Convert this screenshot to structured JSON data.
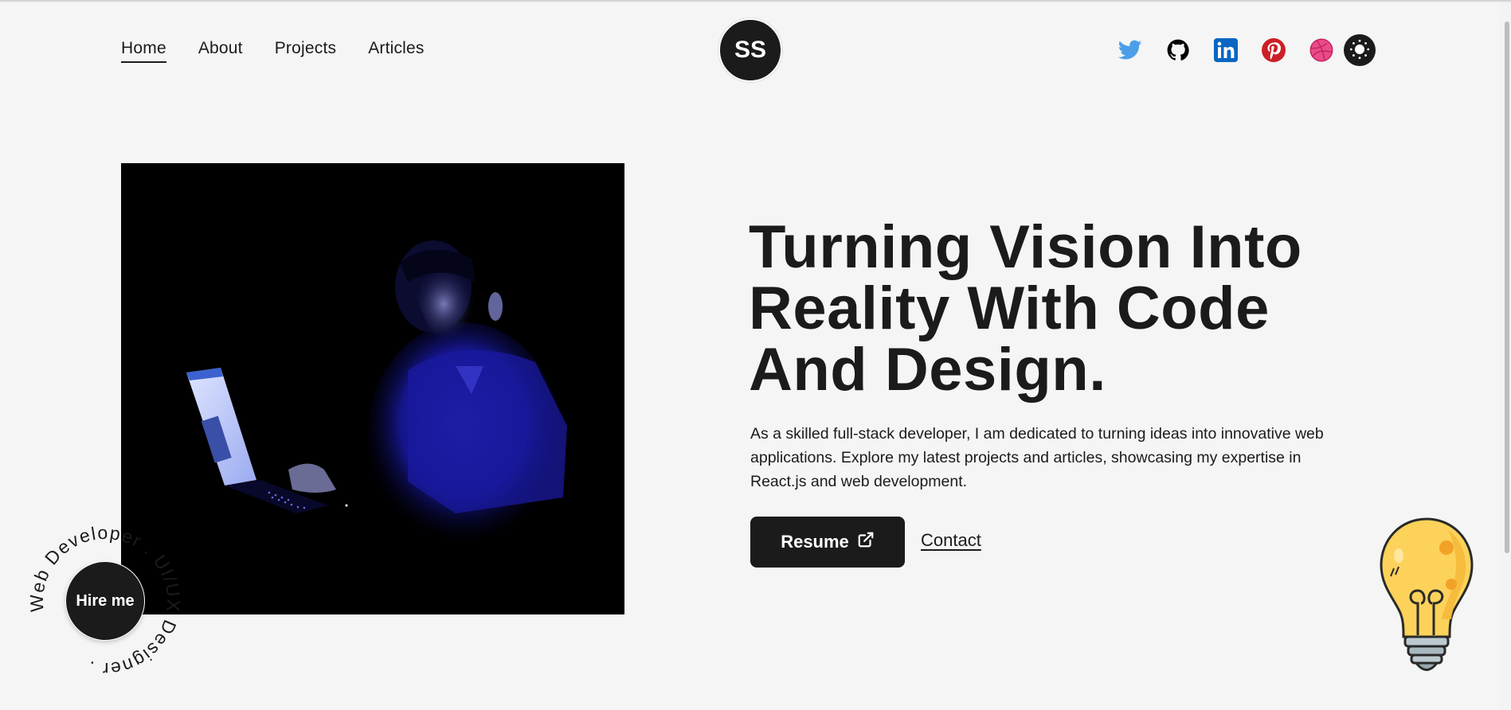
{
  "nav": {
    "links": [
      {
        "label": "Home",
        "active": true
      },
      {
        "label": "About",
        "active": false
      },
      {
        "label": "Projects",
        "active": false
      },
      {
        "label": "Articles",
        "active": false
      }
    ],
    "logo_text": "SS"
  },
  "socials": [
    {
      "name": "twitter",
      "icon": "twitter-icon",
      "color": "#4a9fe8"
    },
    {
      "name": "github",
      "icon": "github-icon",
      "color": "#000000"
    },
    {
      "name": "linkedin",
      "icon": "linkedin-icon",
      "color": "#0a66c2"
    },
    {
      "name": "pinterest",
      "icon": "pinterest-icon",
      "color": "#cb2027"
    },
    {
      "name": "dribbble",
      "icon": "dribbble-icon",
      "color": "#ea4c89"
    }
  ],
  "theme_toggle": {
    "icon": "sun-icon",
    "mode": "light"
  },
  "hero": {
    "image_alt": "Developer working on laptop in dark room lit by blue light",
    "title_lines": [
      "Turning Vision Into",
      "Reality With Code",
      "And Design."
    ],
    "description": "As a skilled full-stack developer, I am dedicated to turning ideas into innovative web applications. Explore my latest projects and articles, showcasing my expertise in React.js and web development.",
    "resume_label": "Resume",
    "contact_label": "Contact"
  },
  "hire_badge": {
    "label": "Hire me",
    "ring_text": "Web Developer . UI/UX Designer . "
  },
  "colors": {
    "background": "#f5f5f5",
    "dark": "#1b1b1b",
    "light": "#ffffff"
  }
}
